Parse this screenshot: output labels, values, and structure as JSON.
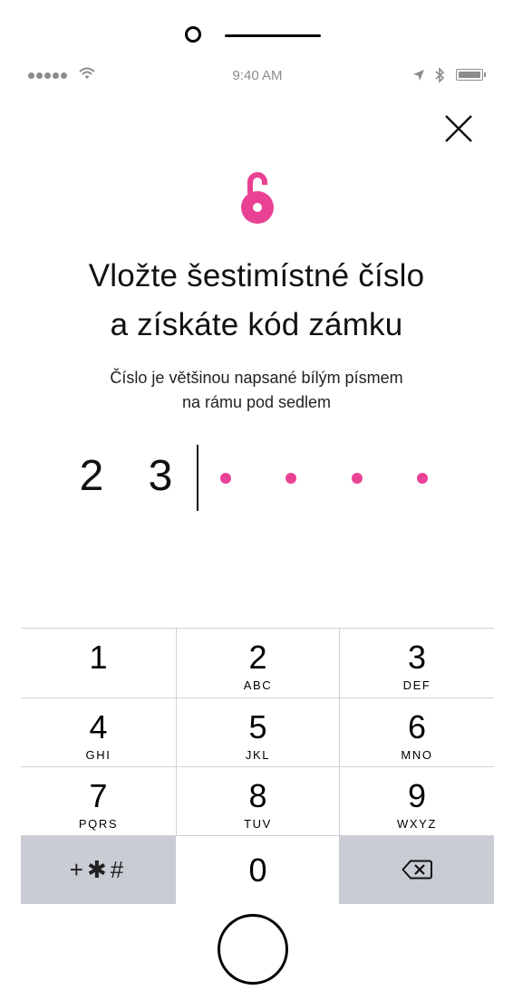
{
  "status_bar": {
    "signal": "signal-dots",
    "wifi": "wifi-icon",
    "time": "9:40 AM",
    "location": "location-arrow-icon",
    "bluetooth": "bluetooth-icon",
    "battery": "battery-icon"
  },
  "header": {
    "close_icon": "close-icon",
    "lock_icon": "unlocked-padlock-icon",
    "accent_color": "#e94295"
  },
  "title": {
    "line1": "Vložte šestimístné číslo",
    "line2": "a získáte kód zámku"
  },
  "subtitle": {
    "line1": "Číslo je většinou napsané bílým písmem",
    "line2": "na rámu pod sedlem"
  },
  "code": {
    "entered": [
      "2",
      "3"
    ],
    "remaining_placeholders": 4
  },
  "keypad": {
    "keys": [
      {
        "num": "1",
        "letters": ""
      },
      {
        "num": "2",
        "letters": "ABC"
      },
      {
        "num": "3",
        "letters": "DEF"
      },
      {
        "num": "4",
        "letters": "GHI"
      },
      {
        "num": "5",
        "letters": "JKL"
      },
      {
        "num": "6",
        "letters": "MNO"
      },
      {
        "num": "7",
        "letters": "PQRS"
      },
      {
        "num": "8",
        "letters": "TUV"
      },
      {
        "num": "9",
        "letters": "WXYZ"
      },
      {
        "num": "0",
        "letters": ""
      }
    ],
    "symbols_label": "+✱#",
    "delete_icon": "backspace-icon"
  }
}
